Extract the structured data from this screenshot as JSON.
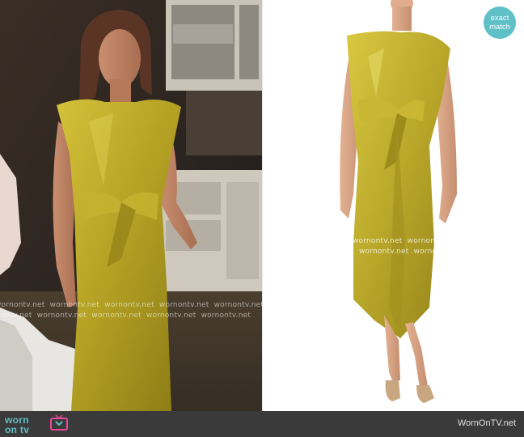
{
  "watermark": {
    "text": "wornontv.net"
  },
  "badge": {
    "line1": "exact",
    "line2": "match"
  },
  "footer": {
    "logo_line1": "worn",
    "logo_line2": "on tv",
    "site": "WornOnTV.net"
  },
  "colors": {
    "accent": "#5fc0c7",
    "dress": "#b9aa27",
    "footer_bg": "#3a3a3a"
  }
}
